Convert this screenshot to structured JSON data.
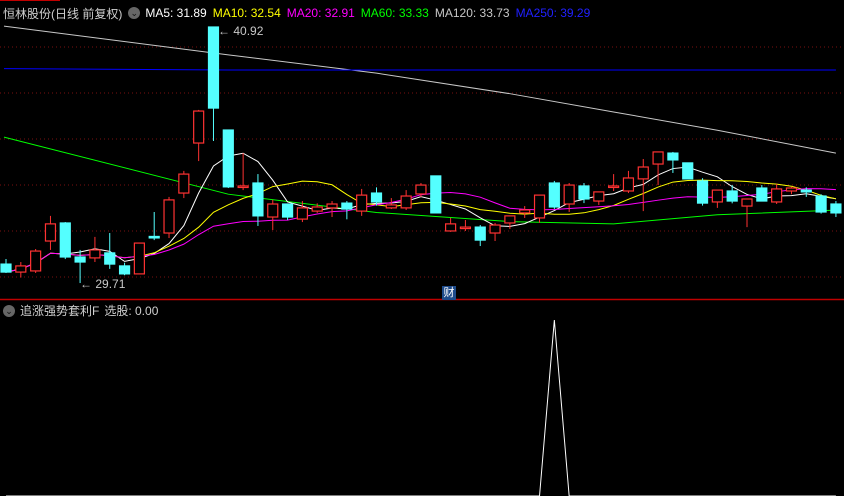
{
  "header": {
    "title": "恒林股份(日线 前复权)",
    "ma": [
      {
        "label": "MA5: 31.89",
        "color": "#ffffff"
      },
      {
        "label": "MA10: 32.54",
        "color": "#ffff00"
      },
      {
        "label": "MA20: 32.91",
        "color": "#ff00ff"
      },
      {
        "label": "MA60: 33.33",
        "color": "#00ff00"
      },
      {
        "label": "MA120: 33.73",
        "color": "#c8c8c8"
      },
      {
        "label": "MA250: 39.29",
        "color": "#0000ff"
      }
    ]
  },
  "indicator": {
    "name": "追涨强势套利F",
    "value_label": "选股: 0.00"
  },
  "badge": "财",
  "chart_data": [
    {
      "type": "candlestick",
      "title": "恒林股份(日线 前复权)",
      "up_color": "#ff3232",
      "down_color": "#54ffff",
      "annotations": {
        "high": "40.92",
        "low": "29.71"
      },
      "ohlc": [
        [
          30.54,
          30.76,
          30.15,
          30.19
        ],
        [
          30.19,
          30.63,
          29.95,
          30.46
        ],
        [
          30.24,
          31.2,
          30.15,
          31.11
        ],
        [
          31.55,
          32.65,
          31.16,
          32.3
        ],
        [
          32.34,
          32.38,
          30.76,
          30.85
        ],
        [
          30.85,
          31.16,
          29.71,
          30.63
        ],
        [
          30.81,
          31.73,
          30.63,
          31.16
        ],
        [
          31.03,
          31.9,
          30.33,
          30.54
        ],
        [
          30.46,
          30.6,
          30.05,
          30.11
        ],
        [
          30.11,
          31.46,
          30.11,
          31.46
        ],
        [
          31.75,
          32.82,
          31.59,
          31.73
        ],
        [
          31.9,
          33.48,
          31.68,
          33.35
        ],
        [
          33.65,
          34.62,
          33.43,
          34.48
        ],
        [
          35.84,
          37.29,
          35.05,
          37.24
        ],
        [
          40.92,
          40.92,
          35.93,
          37.37
        ],
        [
          36.41,
          36.41,
          33.87,
          33.92
        ],
        [
          33.92,
          35.4,
          33.78,
          33.96
        ],
        [
          34.09,
          34.48,
          32.21,
          32.65
        ],
        [
          32.6,
          33.35,
          32.03,
          33.17
        ],
        [
          33.17,
          33.17,
          32.47,
          32.6
        ],
        [
          32.51,
          33.3,
          32.38,
          33.0
        ],
        [
          32.86,
          33.2,
          32.78,
          33.04
        ],
        [
          33.0,
          33.3,
          32.6,
          33.17
        ],
        [
          33.21,
          33.3,
          32.5,
          32.95
        ],
        [
          32.86,
          33.83,
          32.65,
          33.56
        ],
        [
          33.65,
          33.9,
          33.1,
          33.26
        ],
        [
          33.0,
          33.43,
          32.95,
          33.13
        ],
        [
          33.0,
          33.78,
          32.91,
          33.52
        ],
        [
          33.61,
          34.09,
          33.48,
          34.0
        ],
        [
          34.4,
          34.4,
          32.78,
          32.78
        ],
        [
          31.99,
          32.56,
          31.95,
          32.3
        ],
        [
          32.14,
          32.47,
          31.99,
          32.16
        ],
        [
          32.16,
          32.25,
          31.33,
          31.59
        ],
        [
          31.9,
          32.34,
          31.55,
          32.25
        ],
        [
          32.34,
          32.65,
          32.08,
          32.65
        ],
        [
          32.78,
          33.08,
          32.56,
          32.91
        ],
        [
          32.56,
          33.56,
          32.35,
          33.56
        ],
        [
          34.09,
          34.18,
          32.95,
          33.04
        ],
        [
          33.17,
          34.09,
          32.82,
          34.0
        ],
        [
          33.96,
          34.09,
          33.21,
          33.39
        ],
        [
          33.3,
          33.7,
          33.13,
          33.7
        ],
        [
          33.94,
          34.48,
          33.74,
          33.96
        ],
        [
          33.74,
          34.62,
          33.65,
          34.31
        ],
        [
          34.27,
          35.14,
          32.86,
          34.79
        ],
        [
          34.92,
          35.45,
          34.0,
          35.45
        ],
        [
          35.4,
          35.45,
          34.53,
          35.1
        ],
        [
          34.97,
          34.97,
          34.27,
          34.27
        ],
        [
          34.18,
          34.3,
          33.1,
          33.21
        ],
        [
          33.26,
          33.78,
          33.0,
          33.78
        ],
        [
          33.74,
          34.0,
          33.2,
          33.3
        ],
        [
          33.08,
          33.39,
          32.16,
          33.39
        ],
        [
          33.87,
          34.0,
          33.28,
          33.3
        ],
        [
          33.26,
          34.05,
          33.17,
          33.83
        ],
        [
          33.74,
          33.92,
          33.6,
          33.87
        ],
        [
          33.78,
          33.9,
          33.48,
          33.7
        ],
        [
          33.52,
          33.6,
          32.75,
          32.82
        ],
        [
          33.17,
          33.3,
          32.6,
          32.78
        ]
      ],
      "long_ma_samples": {
        "index": [
          0,
          15,
          25,
          34,
          41,
          48,
          56
        ],
        "MA60": [
          36.1,
          33.6,
          32.8,
          32.4,
          32.3,
          32.7,
          32.9
        ],
        "MA120": [
          40.96,
          39.7,
          38.9,
          38.0,
          37.2,
          36.4,
          35.4
        ],
        "MA250": [
          39.1,
          39.04,
          39.04,
          39.04,
          39.04,
          39.04,
          39.04
        ]
      },
      "price_range": [
        29.2,
        41.2
      ]
    },
    {
      "type": "line",
      "title": "追涨强势套利F",
      "series": [
        {
          "name": "选股",
          "values": [
            0,
            0,
            0,
            0,
            0,
            0,
            0,
            0,
            0,
            0,
            0,
            0,
            0,
            0,
            0,
            0,
            0,
            0,
            0,
            0,
            0,
            0,
            0,
            0,
            0,
            0,
            0,
            0,
            0,
            0,
            0,
            0,
            0,
            0,
            0,
            0,
            0,
            1,
            0,
            0,
            0,
            0,
            0,
            0,
            0,
            0,
            0,
            0,
            0,
            0,
            0,
            0,
            0,
            0,
            0,
            0,
            0
          ]
        }
      ],
      "ylim": [
        0,
        1.1
      ]
    }
  ]
}
